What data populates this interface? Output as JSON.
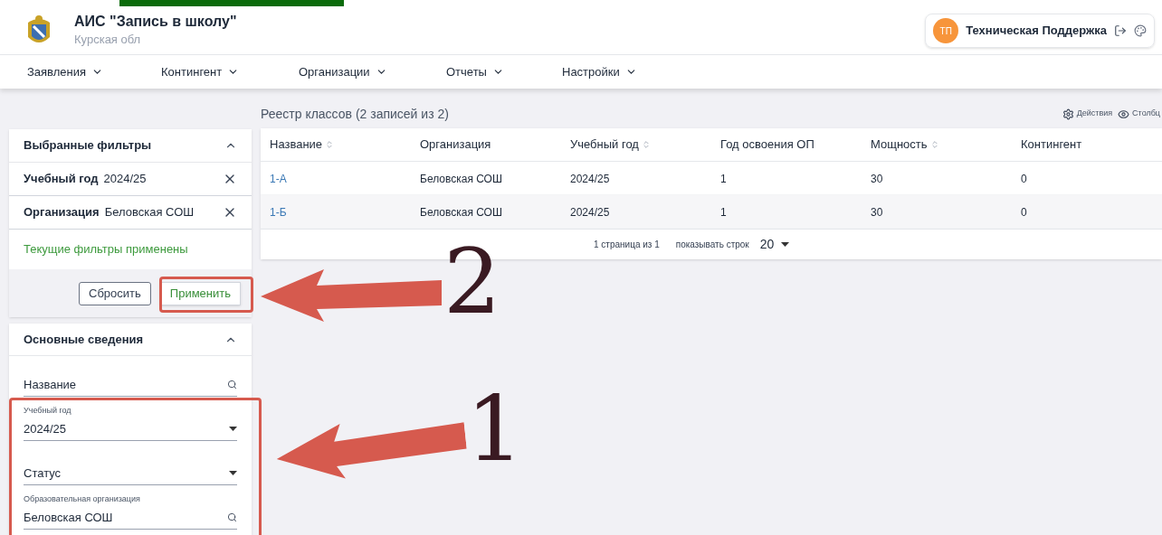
{
  "header": {
    "title": "АИС \"Запись в школу\"",
    "subtitle": "Курская обл",
    "user": {
      "initials": "ТП",
      "name": "Техническая Поддержка"
    }
  },
  "nav": [
    {
      "label": "Заявления"
    },
    {
      "label": "Контингент"
    },
    {
      "label": "Организации"
    },
    {
      "label": "Отчеты"
    },
    {
      "label": "Настройки"
    }
  ],
  "registry": {
    "title": "Реестр классов (2 записей из 2)",
    "actions": [
      {
        "kind": "settings",
        "label": "Действия"
      },
      {
        "kind": "columns",
        "label": "Столбц"
      }
    ]
  },
  "table": {
    "columns": [
      {
        "label": "Название",
        "sortable": true
      },
      {
        "label": "Организация",
        "sortable": false
      },
      {
        "label": "Учебный год",
        "sortable": true
      },
      {
        "label": "Год освоения ОП",
        "sortable": false
      },
      {
        "label": "Мощность",
        "sortable": true
      },
      {
        "label": "Контингент",
        "sortable": false
      }
    ],
    "rows": [
      [
        "1-А",
        "Беловская СОШ",
        "2024/25",
        "1",
        "30",
        "0"
      ],
      [
        "1-Б",
        "Беловская СОШ",
        "2024/25",
        "1",
        "30",
        "0"
      ]
    ],
    "footer": {
      "pages": "1 страница из 1",
      "rows_label": "показывать строк",
      "rows_value": "20"
    }
  },
  "selected_filters": {
    "title": "Выбранные фильтры",
    "expanded": true,
    "items": [
      {
        "label": "Учебный год",
        "value": "2024/25"
      },
      {
        "label": "Организация",
        "value": "Беловская СОШ"
      }
    ],
    "status": "Текущие фильтры применены",
    "buttons": [
      {
        "kind": "secondary",
        "label": "Сбросить"
      },
      {
        "kind": "primary",
        "label": "Применить"
      }
    ]
  },
  "basic_info": {
    "title": "Основные сведения",
    "expanded": true,
    "fields": [
      {
        "kind": "search",
        "placeholder": "Название"
      },
      {
        "kind": "select",
        "label": "Учебный год",
        "value": "2024/25"
      },
      {
        "kind": "select",
        "placeholder": "Статус"
      },
      {
        "kind": "search",
        "label": "Образовательная организация",
        "value": "Беловская СОШ"
      }
    ]
  },
  "annotations": [
    {
      "number": "2"
    },
    {
      "number": "1"
    }
  ]
}
